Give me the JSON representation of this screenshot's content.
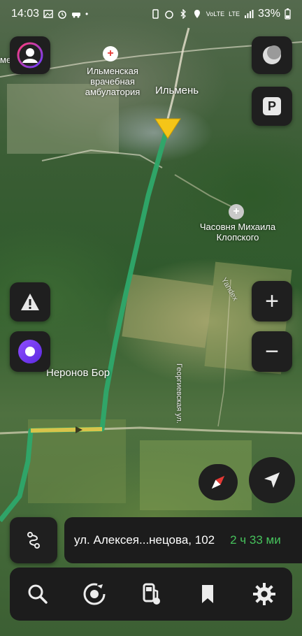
{
  "status_bar": {
    "time": "14:03",
    "battery_percent": "33%",
    "network_label": "VoLTE",
    "lte_label": "LTE"
  },
  "map": {
    "labels": {
      "hospital_name": "Ильменская\nврачебная\nамбулатория",
      "village_ilmen": "Ильмень",
      "chapel_name": "Часовня Михаила\nКлопского",
      "village_neronov": "Неронов Бор",
      "street_georgievskaya": "Георгиевская ул.",
      "watermark": "Yandex",
      "edge_cut_label": "ме"
    },
    "route_color": "#2ea86a"
  },
  "buttons": {
    "profile": "avatar",
    "layers": "layers",
    "parking": "P",
    "alert": "!",
    "alice": "alice",
    "zoom_in": "+",
    "zoom_out": "−"
  },
  "route_panel": {
    "address": "ул. Алексея...нецова, 102",
    "eta": "2 ч 33 ми"
  },
  "bottom_nav": {
    "items": [
      "search",
      "music",
      "fuel",
      "bookmarks",
      "settings"
    ]
  },
  "colors": {
    "panel_bg": "#1c1c1c",
    "eta_green": "#46c25c",
    "accent_red": "#e53935",
    "alice_purple": "#7b3fe4",
    "location_yellow": "#f5c518"
  }
}
